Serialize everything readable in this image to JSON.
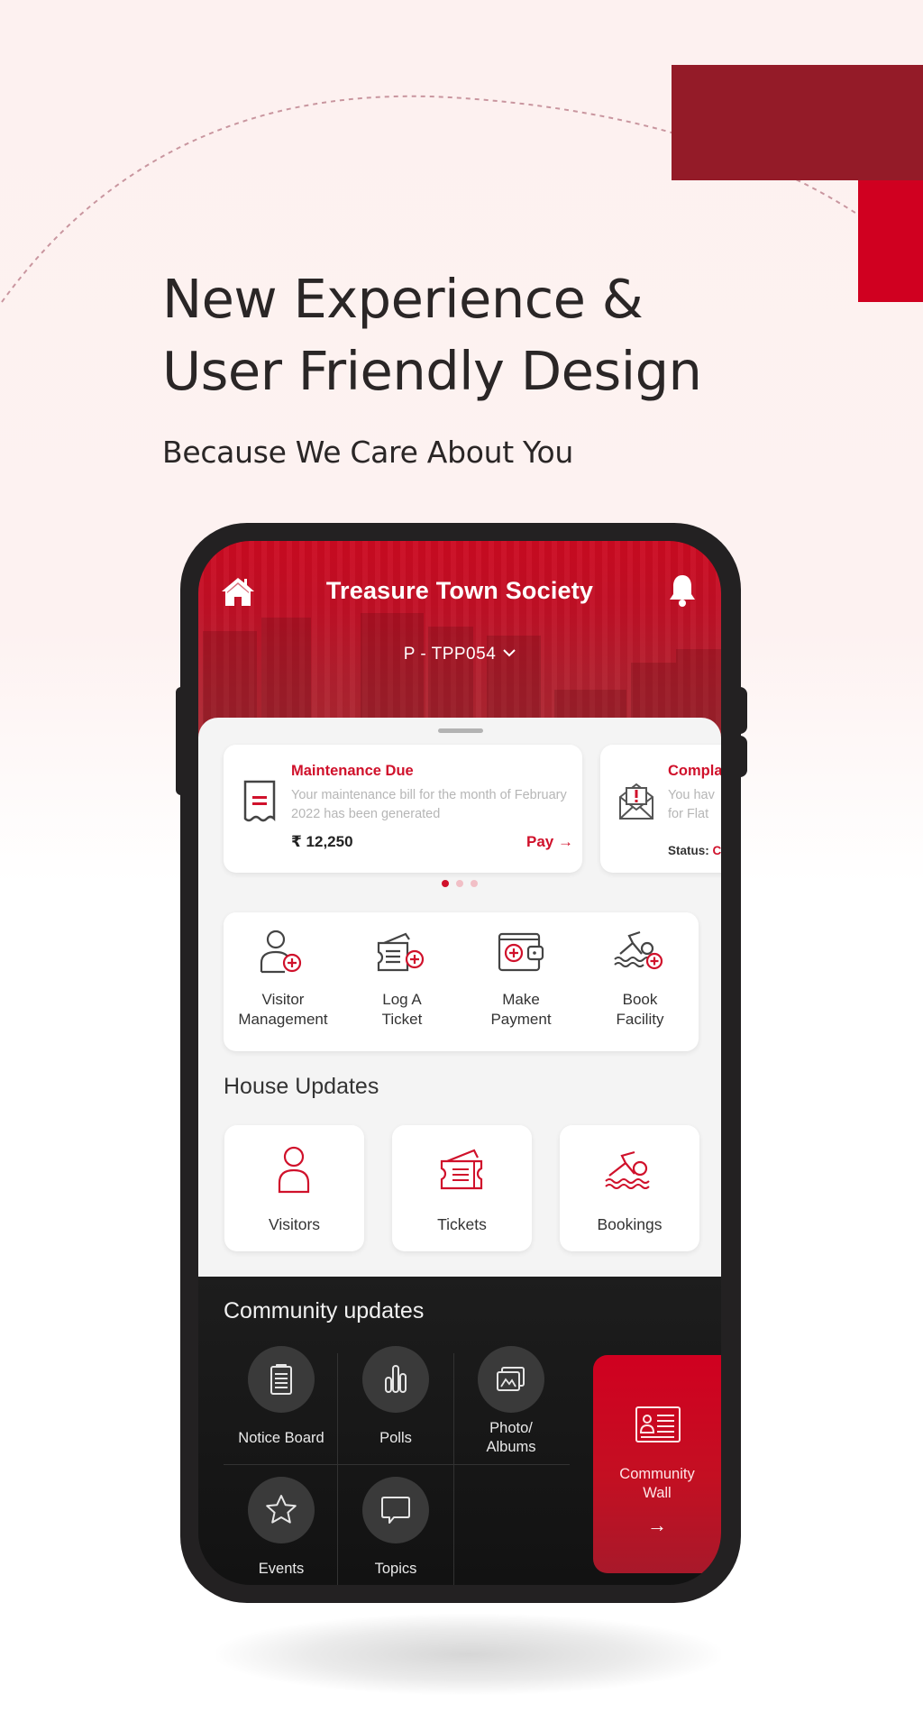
{
  "hero": {
    "headline_line1": "New Experience &",
    "headline_line2": "User Friendly Design",
    "subline": "Because We Care About You"
  },
  "colors": {
    "brand_red": "#d00020",
    "brand_dark_red": "#941b28",
    "text_dark": "#2a2626"
  },
  "app": {
    "header": {
      "home_icon": "home-icon",
      "title": "Treasure Town Society",
      "bell_icon": "bell-icon",
      "unit": "P - TPP054"
    },
    "cards": [
      {
        "icon": "receipt-icon",
        "title": "Maintenance Due",
        "description": "Your maintenance bill for the month of February 2022 has been generated",
        "amount": "₹ 12,250",
        "action": "Pay →"
      },
      {
        "icon": "complaint-envelope-icon",
        "title": "Compla",
        "description_line1": "You hav",
        "description_line2": "for Flat",
        "status_label": "Status:",
        "status_value": "C"
      }
    ],
    "carousel": {
      "count": 3,
      "active": 0
    },
    "quick_actions": [
      {
        "icon": "add-visitor-icon",
        "line1": "Visitor",
        "line2": "Management"
      },
      {
        "icon": "add-ticket-icon",
        "line1": "Log A",
        "line2": "Ticket"
      },
      {
        "icon": "wallet-add-icon",
        "line1": "Make",
        "line2": "Payment"
      },
      {
        "icon": "swim-add-icon",
        "line1": "Book",
        "line2": "Facility"
      }
    ],
    "house_updates": {
      "title": "House Updates",
      "tiles": [
        {
          "icon": "visitor-icon",
          "label": "Visitors"
        },
        {
          "icon": "ticket-icon",
          "label": "Tickets"
        },
        {
          "icon": "swimming-icon",
          "label": "Bookings"
        }
      ]
    },
    "community_updates": {
      "title": "Community updates",
      "items": [
        {
          "icon": "notice-board-icon",
          "line1": "Notice Board",
          "line2": ""
        },
        {
          "icon": "polls-icon",
          "line1": "Polls",
          "line2": ""
        },
        {
          "icon": "photo-albums-icon",
          "line1": "Photo/",
          "line2": "Albums"
        },
        {
          "icon": "star-icon",
          "line1": "Events",
          "line2": ""
        },
        {
          "icon": "chat-bubble-icon",
          "line1": "Topics",
          "line2": ""
        }
      ],
      "wall": {
        "icon": "id-card-icon",
        "line1": "Community",
        "line2": "Wall",
        "arrow": "→"
      }
    }
  }
}
